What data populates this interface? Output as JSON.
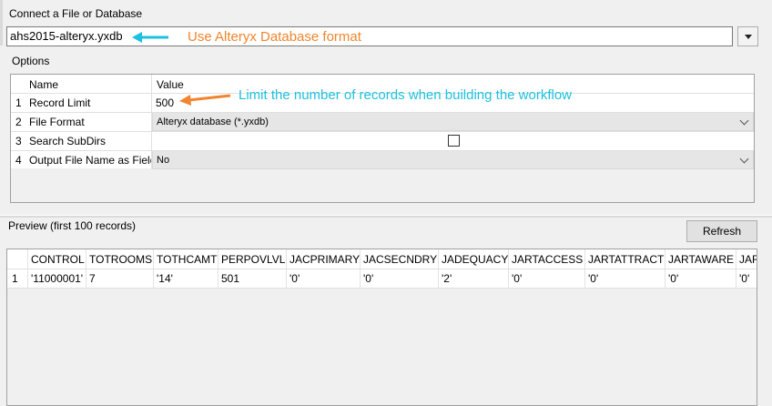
{
  "connect": {
    "label": "Connect a File or Database",
    "file_value": "ahs2015-alteryx.yxdb",
    "annotation": "Use Alteryx Database format"
  },
  "options": {
    "label": "Options",
    "header_name": "Name",
    "header_value": "Value",
    "rows": [
      {
        "num": "1",
        "name": "Record Limit",
        "value": "500"
      },
      {
        "num": "2",
        "name": "File Format",
        "value": "Alteryx database (*.yxdb)"
      },
      {
        "num": "3",
        "name": "Search SubDirs",
        "value": ""
      },
      {
        "num": "4",
        "name": "Output File Name as Field",
        "value": "No"
      }
    ],
    "annotation": "Limit the number of records when building the workflow"
  },
  "preview": {
    "label": "Preview (first 100 records)",
    "refresh_label": "Refresh",
    "columns": [
      "CONTROL",
      "TOTROOMS",
      "TOTHCAMT",
      "PERPOVLVL",
      "JACPRIMARY",
      "JACSECNDRY",
      "JADEQUACY",
      "JARTACCESS",
      "JARTATTRACT",
      "JARTAWARE",
      "JAR"
    ],
    "row_num": "1",
    "row": [
      "'11000001'",
      "7",
      "'14'",
      "501",
      "'0'",
      "'0'",
      "'2'",
      "'0'",
      "'0'",
      "'0'",
      "'0'"
    ]
  },
  "colors": {
    "annotation_orange": "#f0852d",
    "annotation_cyan": "#1dc1e0"
  }
}
